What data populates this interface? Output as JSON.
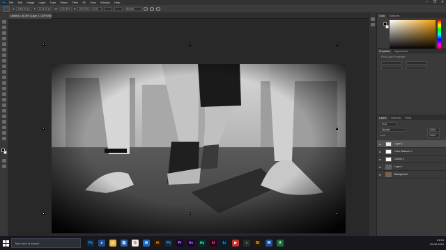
{
  "menubar": {
    "logo": "Ps",
    "items": [
      "File",
      "Edit",
      "Image",
      "Layer",
      "Type",
      "Select",
      "Filter",
      "3D",
      "View",
      "Window",
      "Help"
    ],
    "window_controls": [
      "–",
      "❐",
      "✕"
    ]
  },
  "options": {
    "x_label": "X:",
    "x_value": "2064.00 px",
    "y_label": "Y:",
    "y_value": "1376.00 px",
    "w_label": "W:",
    "w_value": "100.00%",
    "h_label": "H:",
    "h_value": "100.00%",
    "angle_value": "0.00",
    "interp_value": "Bicubic"
  },
  "document": {
    "tab_title": "Untitled-1 @ 25% (Layer 2, CMYK/8#) *"
  },
  "panels": {
    "color": {
      "tabs": [
        "Color",
        "Swatches"
      ],
      "fg": "#000000",
      "bg": "#ffffff"
    },
    "properties": {
      "tabs": [
        "Properties",
        "Adjustments"
      ],
      "heading": "Pixel Layer Properties"
    },
    "layers": {
      "tabs": [
        "Layers",
        "Channels",
        "Paths"
      ],
      "kind_filter": "Kind",
      "blend_mode": "Normal",
      "opacity": "100%",
      "lock_label": "Lock:",
      "fill": "100%",
      "items": [
        {
          "name": "Layer 2",
          "thumb": "#e8e8e8",
          "selected": true
        },
        {
          "name": "Color Balance 1",
          "thumb": "#ffffff",
          "selected": false
        },
        {
          "name": "Curves 1",
          "thumb": "#ffffff",
          "selected": false
        },
        {
          "name": "Layer 1",
          "thumb": "#606060",
          "selected": false
        },
        {
          "name": "Background",
          "thumb": "#8a5a3a",
          "selected": false
        }
      ]
    }
  },
  "taskbar": {
    "search_placeholder": "Type here to search",
    "apps": [
      "Ps",
      "e",
      "📁",
      "🛍",
      "G",
      "✉",
      "Ai",
      "Ps",
      "Pr",
      "Ae",
      "Au",
      "Id",
      "Lr",
      "▶",
      "●",
      "Br",
      "W",
      "X"
    ],
    "time": "21:54",
    "date": "19-08-2019"
  }
}
